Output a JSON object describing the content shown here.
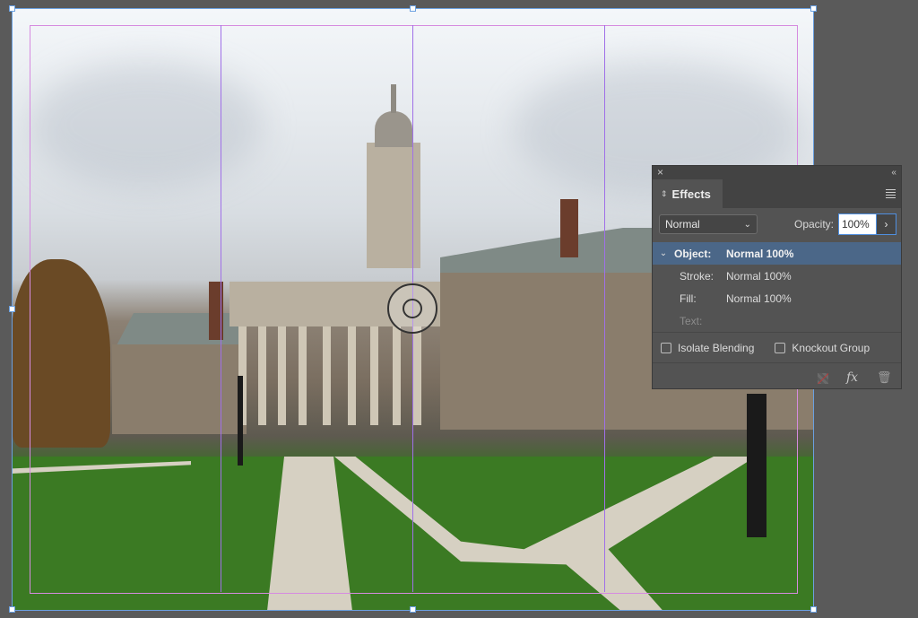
{
  "document": {
    "image_description": "Photo of Old Main building with clock tower, lawns and walkways",
    "colors": {
      "pasteboard": "#5a5a5a",
      "frame_stroke": "#6aa0e0",
      "margin_guide": "#d68be0",
      "column_guide": "#a070e8"
    }
  },
  "effects_panel": {
    "close_label": "×",
    "collapse_label": "‹‹",
    "tab_label": "Effects",
    "blend_mode": "Normal",
    "opacity_label": "Opacity:",
    "opacity_value": "100%",
    "rows": [
      {
        "name": "Object:",
        "value": "Normal 100%",
        "selected": true
      },
      {
        "name": "Stroke:",
        "value": "Normal 100%"
      },
      {
        "name": "Fill:",
        "value": "Normal 100%"
      },
      {
        "name": "Text:",
        "value": "",
        "disabled": true
      }
    ],
    "isolate_blending_label": "Isolate Blending",
    "isolate_blending_checked": false,
    "knockout_group_label": "Knockout Group",
    "knockout_group_checked": false,
    "fx_label": "fx"
  }
}
